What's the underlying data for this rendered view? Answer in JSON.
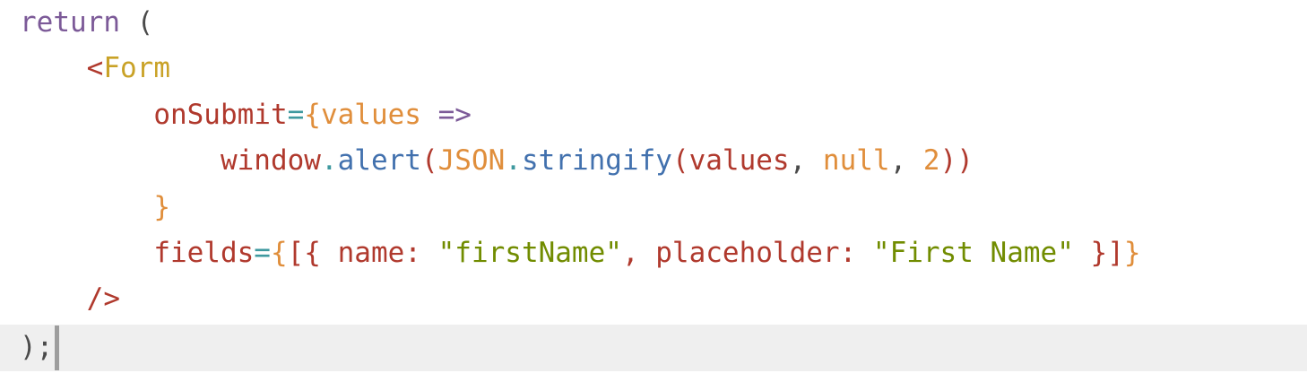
{
  "editor": {
    "lines": [
      {
        "tokens": [
          {
            "text": "return",
            "kind": "keyword"
          },
          {
            "text": " ",
            "kind": "space"
          },
          {
            "text": "(",
            "kind": "punctuation"
          }
        ]
      },
      {
        "tokens": [
          {
            "text": "    ",
            "kind": "indent"
          },
          {
            "text": "<",
            "kind": "tag-bracket"
          },
          {
            "text": "Form",
            "kind": "tag-name"
          }
        ]
      },
      {
        "tokens": [
          {
            "text": "        ",
            "kind": "indent"
          },
          {
            "text": "onSubmit",
            "kind": "attribute"
          },
          {
            "text": "=",
            "kind": "operator"
          },
          {
            "text": "{",
            "kind": "brace"
          },
          {
            "text": "values",
            "kind": "parameter"
          },
          {
            "text": " ",
            "kind": "space"
          },
          {
            "text": "=>",
            "kind": "arrow"
          }
        ]
      },
      {
        "tokens": [
          {
            "text": "            ",
            "kind": "indent"
          },
          {
            "text": "window",
            "kind": "variable"
          },
          {
            "text": ".",
            "kind": "dot"
          },
          {
            "text": "alert",
            "kind": "method"
          },
          {
            "text": "(",
            "kind": "paren"
          },
          {
            "text": "JSON",
            "kind": "builtin"
          },
          {
            "text": ".",
            "kind": "dot"
          },
          {
            "text": "stringify",
            "kind": "method"
          },
          {
            "text": "(",
            "kind": "paren"
          },
          {
            "text": "values",
            "kind": "variable"
          },
          {
            "text": ", ",
            "kind": "comma"
          },
          {
            "text": "null",
            "kind": "literal"
          },
          {
            "text": ", ",
            "kind": "comma"
          },
          {
            "text": "2",
            "kind": "number"
          },
          {
            "text": "))",
            "kind": "paren"
          }
        ]
      },
      {
        "tokens": [
          {
            "text": "        ",
            "kind": "indent"
          },
          {
            "text": "}",
            "kind": "brace"
          }
        ]
      },
      {
        "tokens": [
          {
            "text": "        ",
            "kind": "indent"
          },
          {
            "text": "fields",
            "kind": "attribute"
          },
          {
            "text": "=",
            "kind": "operator"
          },
          {
            "text": "{",
            "kind": "brace"
          },
          {
            "text": "[{ ",
            "kind": "object-punct"
          },
          {
            "text": "name",
            "kind": "property"
          },
          {
            "text": ": ",
            "kind": "object-punct"
          },
          {
            "text": "\"firstName\"",
            "kind": "string"
          },
          {
            "text": ", ",
            "kind": "object-punct"
          },
          {
            "text": "placeholder",
            "kind": "property"
          },
          {
            "text": ": ",
            "kind": "object-punct"
          },
          {
            "text": "\"First Name\"",
            "kind": "string"
          },
          {
            "text": " }]",
            "kind": "object-punct"
          },
          {
            "text": "}",
            "kind": "brace"
          }
        ]
      },
      {
        "tokens": [
          {
            "text": "    ",
            "kind": "indent"
          },
          {
            "text": "/>",
            "kind": "tag-close"
          }
        ]
      },
      {
        "tokens": [
          {
            "text": ");",
            "kind": "punctuation"
          }
        ],
        "active": true
      }
    ]
  },
  "colors": {
    "keyword": "#7c5a98",
    "punctuation": "#4a4a4a",
    "tag-bracket": "#b0392d",
    "tag-name": "#c9a227",
    "attribute": "#b0392d",
    "operator": "#3e999f",
    "brace": "#e08e3b",
    "parameter": "#e08e3b",
    "arrow": "#7c5a98",
    "variable": "#b0392d",
    "dot": "#3e999f",
    "method": "#4271ae",
    "paren": "#b0392d",
    "builtin": "#e08e3b",
    "comma": "#4a4a4a",
    "literal": "#e08e3b",
    "number": "#e08e3b",
    "object-punct": "#b0392d",
    "property": "#b0392d",
    "string": "#718c00",
    "tag-close": "#b0392d",
    "indent": "#4a4a4a",
    "space": "#4a4a4a",
    "active-line-bg": "#efefef",
    "caret": "#9d9d9d"
  }
}
